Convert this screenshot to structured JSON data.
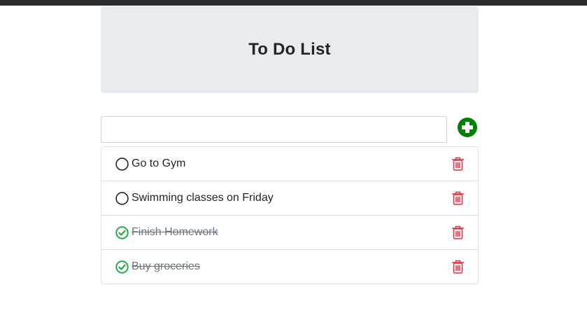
{
  "header": {
    "title": "To Do List"
  },
  "new_todo": {
    "value": "",
    "placeholder": ""
  },
  "colors": {
    "accent_add": "#008000",
    "done_check": "#28a745",
    "delete": "#dc3545",
    "header_bg": "#e9ecef"
  },
  "icons": {
    "add": "plus-circle-icon",
    "pending": "circle-outline-icon",
    "done": "check-circle-icon",
    "delete": "trash-icon"
  },
  "todos": [
    {
      "text": "Go to Gym",
      "done": false
    },
    {
      "text": "Swimming classes on Friday",
      "done": false
    },
    {
      "text": "Finish Homework",
      "done": true
    },
    {
      "text": "Buy groceries",
      "done": true
    }
  ]
}
